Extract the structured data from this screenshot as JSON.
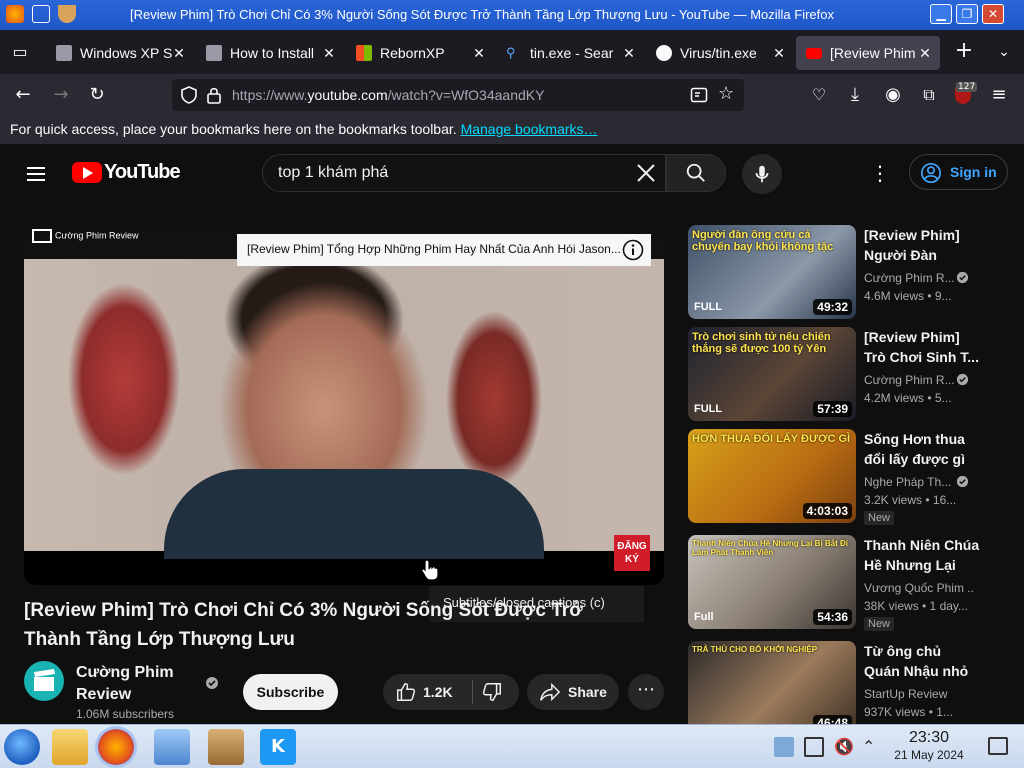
{
  "window": {
    "title": "[Review Phim] Trò Chơi Chỉ Có 3% Người Sống Sót Được Trở Thành Tầng Lớp Thượng Lưu - YouTube — Mozilla Firefox"
  },
  "tabs": [
    {
      "label": "Windows XP S",
      "close": "✕"
    },
    {
      "label": "How to Install",
      "close": "✕"
    },
    {
      "label": "RebornXP",
      "close": "✕"
    },
    {
      "label": "tin.exe - Sear",
      "close": "✕"
    },
    {
      "label": "Virus/tin.exe",
      "close": "✕"
    },
    {
      "label": "[Review Phim",
      "close": "✕"
    }
  ],
  "navbar": {
    "url_prefix": "https://www.",
    "url_domain": "youtube.com",
    "url_rest": "/watch?v=WfO34aandKY",
    "badge": "127"
  },
  "bookmarks": {
    "message": "For quick access, place your bookmarks here on the bookmarks toolbar.",
    "link": "Manage bookmarks…"
  },
  "youtube": {
    "logo_text": "YouTube",
    "search_query": "top 1 khám phá",
    "signin_label": "Sign in",
    "player": {
      "channel_watermark": "Cường Phim Review",
      "overlay_title": "[Review Phim] Tổng Hợp Những Phim Hay Nhất Của Anh Hói Jason...",
      "stamp_line1": "ĐĂNG",
      "stamp_line2": "KÝ",
      "tooltip": "Subtitles/closed captions (c)"
    },
    "video_title": "[Review Phim] Trò Chơi Chỉ Có 3% Người Sống Sót Được Trở Thành Tầng Lớp Thượng Lưu",
    "channel": {
      "name_line1": "Cường Phim",
      "name_line2": "Review",
      "subscribers": "1.06M subscribers"
    },
    "subscribe_label": "Subscribe",
    "like_count": "1.2K",
    "share_label": "Share",
    "recommendations": [
      {
        "title": "[Review Phim] Người Đàn Ông...",
        "channel": "Cường Phim R...",
        "meta": "4.6M views • 9...",
        "duration": "49:32",
        "thumb_text": "Người đàn ông cứu cả chuyến bay khỏi không tặc",
        "thumb_tag": "FULL",
        "new": ""
      },
      {
        "title": "[Review Phim] Trò Chơi Sinh T...",
        "channel": "Cường Phim R...",
        "meta": "4.2M views • 5...",
        "duration": "57:39",
        "thumb_text": "Trò chơi sinh tử nếu chiến thắng sẽ được 100 tỷ Yên",
        "thumb_tag": "FULL",
        "new": ""
      },
      {
        "title": "Sống Hơn thua đổi lấy được gì ...",
        "channel": "Nghe Pháp Th...",
        "meta": "3.2K views • 16...",
        "duration": "4:03:03",
        "thumb_text": "HƠN THUA ĐỔI LẤY ĐƯỢC GÌ",
        "thumb_tag": "",
        "new": "New"
      },
      {
        "title": "Thanh Niên Chúa Hề Nhưng Lại Bị...",
        "channel": "Vương Quốc Phim ...",
        "meta": "38K views • 1 day...",
        "duration": "54:36",
        "thumb_text": "Thanh Niên Chúa Hề Nhưng Lại Bị Bắt Đi Làm Phát Thanh Viên",
        "thumb_tag": "Full",
        "new": "New"
      },
      {
        "title": "Từ ông chủ Quán Nhậu nhỏ ở...",
        "channel": "StartUp Review",
        "meta": "937K views • 1...",
        "duration": "46:48",
        "thumb_text": "TRẢ THÙ CHO BỐ   KHỞI NGHIỆP",
        "thumb_tag": "",
        "new": ""
      }
    ]
  },
  "taskbar": {
    "time": "23:30",
    "date": "21 May 2024"
  },
  "colors": {
    "yt_red": "#ff0000",
    "link_blue": "#3ea6ff",
    "firefox_link": "#00ddff"
  }
}
